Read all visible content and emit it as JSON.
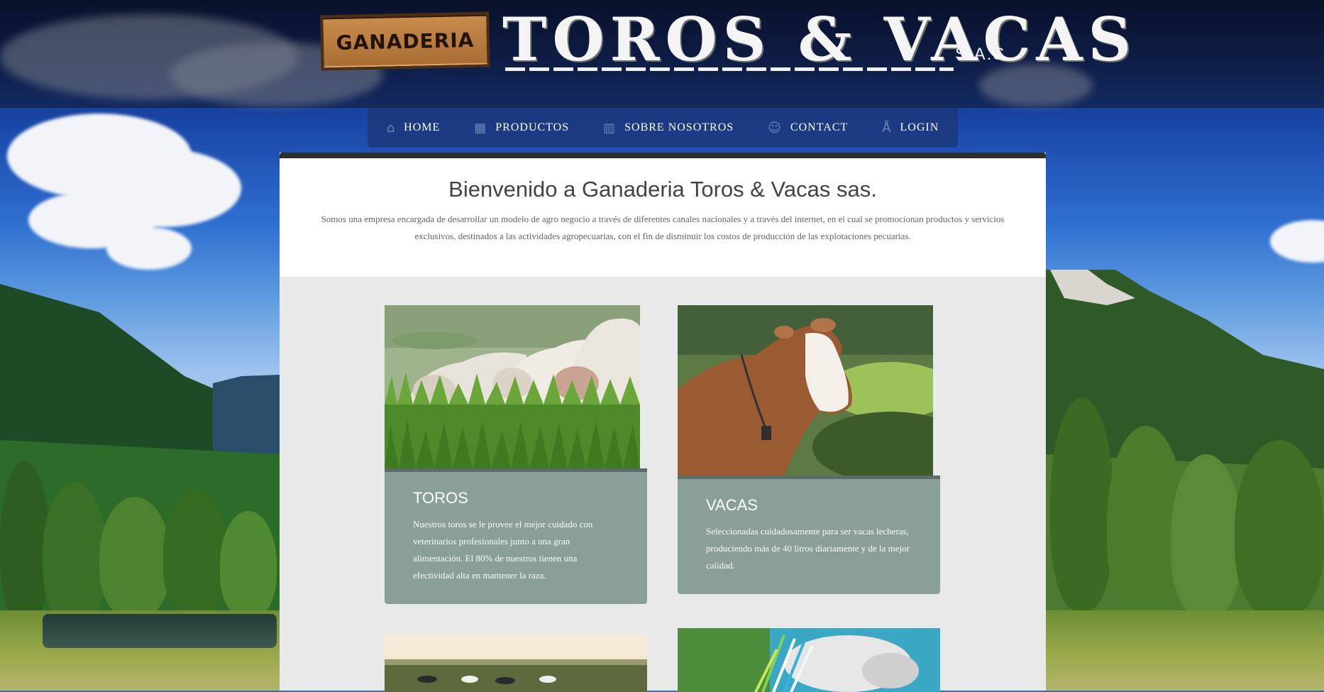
{
  "header": {
    "logo_board_text": "GANADERIA",
    "logo_main_text": "TOROS & VACAS",
    "logo_suffix": "S.A.S."
  },
  "nav": {
    "items": [
      {
        "label": "HOME",
        "icon": "home-icon"
      },
      {
        "label": "PRODUCTOS",
        "icon": "grid-icon"
      },
      {
        "label": "SOBRE NOSOTROS",
        "icon": "book-icon"
      },
      {
        "label": "CONTACT",
        "icon": "people-icon"
      },
      {
        "label": "LOGIN",
        "icon": "user-icon"
      }
    ]
  },
  "intro": {
    "title": "Bienvenido a Ganaderia Toros & Vacas sas.",
    "text": "Somos una empresa encargada de desarrollar un modelo de agro negocio a través de diferentes canales nacionales y a través del internet, en el cual se promocionan productos y servicios exclusivos, destinados a las actividades agropecuarias, con el fin de disminuir los costos de producción de las explotaciones pecuarias."
  },
  "cards": [
    {
      "title": "TOROS",
      "text": "Nuestros toros se le provee el mejor cuidado con veterinarios profesionales junto a una gran alimentación. El 80% de nuestros tienen una efectividad alta en mantener la raza."
    },
    {
      "title": "VACAS",
      "text": "Seleccionadas cuidadosamente para ser vacas lecheras, produciendo más de 40 litros diariamente y de la mejor calidad."
    }
  ],
  "colors": {
    "card_box": "#8a9e9a",
    "nav_bg": "#1c3778",
    "header_bg": "#0f1630"
  }
}
